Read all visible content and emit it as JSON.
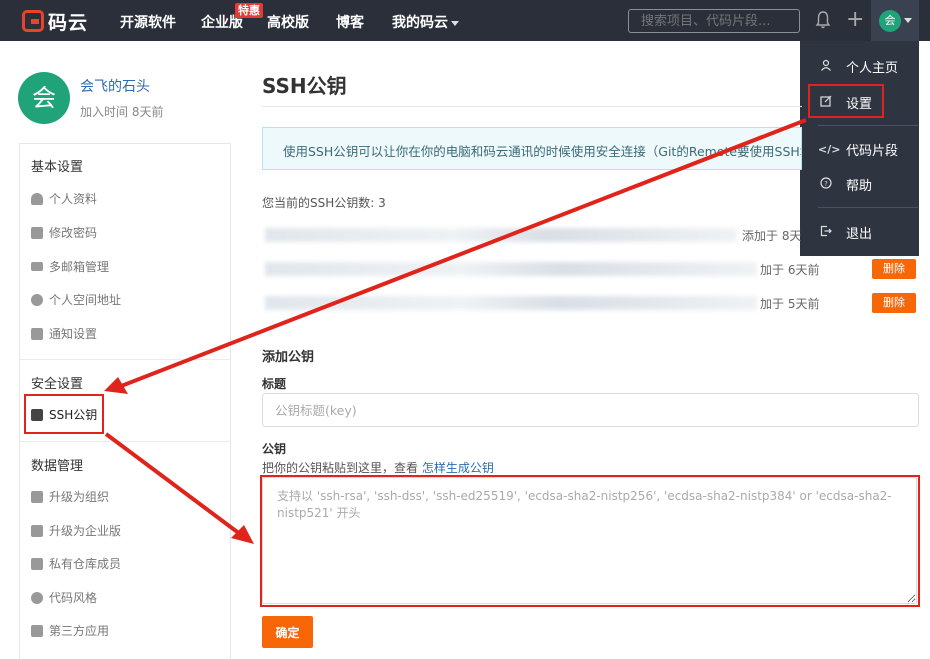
{
  "nav": {
    "logo_text": "码云",
    "items": [
      "开源软件",
      "企业版",
      "高校版",
      "博客",
      "我的码云"
    ],
    "badge": "特惠",
    "search_placeholder": "搜索项目、代码片段...",
    "avatar_text": "会"
  },
  "dropdown": {
    "items": [
      {
        "label": "个人主页",
        "icon": "person-icon"
      },
      {
        "label": "设置",
        "icon": "edit-icon"
      },
      {
        "label": "代码片段",
        "icon": "code-icon"
      },
      {
        "label": "帮助",
        "icon": "help-icon"
      },
      {
        "label": "退出",
        "icon": "logout-icon"
      }
    ]
  },
  "profile": {
    "avatar_text": "会",
    "name": "会飞的石头",
    "joined": "加入时间 8天前"
  },
  "sidebar": {
    "basic_title": "基本设置",
    "basic_items": [
      "个人资料",
      "修改密码",
      "多邮箱管理",
      "个人空间地址",
      "通知设置"
    ],
    "security_title": "安全设置",
    "security_items": [
      "SSH公钥"
    ],
    "data_title": "数据管理",
    "data_items": [
      "升级为组织",
      "升级为企业版",
      "私有仓库成员",
      "代码风格",
      "第三方应用"
    ]
  },
  "main": {
    "title": "SSH公钥",
    "info": "使用SSH公钥可以让你在你的电脑和码云通讯的时候使用安全连接（Git的Remote要使用SSH地",
    "count": "您当前的SSH公钥数: 3",
    "keys": [
      {
        "added": "添加于 8天"
      },
      {
        "added": "加于 6天前",
        "delete": "删除"
      },
      {
        "added": "加于 5天前",
        "delete": "删除"
      }
    ],
    "add_title": "添加公钥",
    "title_label": "标题",
    "title_placeholder": "公钥标题(key)",
    "key_label": "公钥",
    "hint_text": "把你的公钥粘贴到这里，查看 ",
    "hint_link": "怎样生成公钥",
    "key_placeholder": "支持以 'ssh-rsa', 'ssh-dss', 'ssh-ed25519', 'ecdsa-sha2-nistp256', 'ecdsa-sha2-nistp384' or 'ecdsa-sha2-nistp521' 开头",
    "submit": "确定"
  },
  "colors": {
    "nav_bg": "#2a2f3a",
    "accent_orange": "#f76707",
    "brand_red": "#e9432c",
    "avatar_green": "#21a37a",
    "annotation_red": "#e0241b"
  }
}
